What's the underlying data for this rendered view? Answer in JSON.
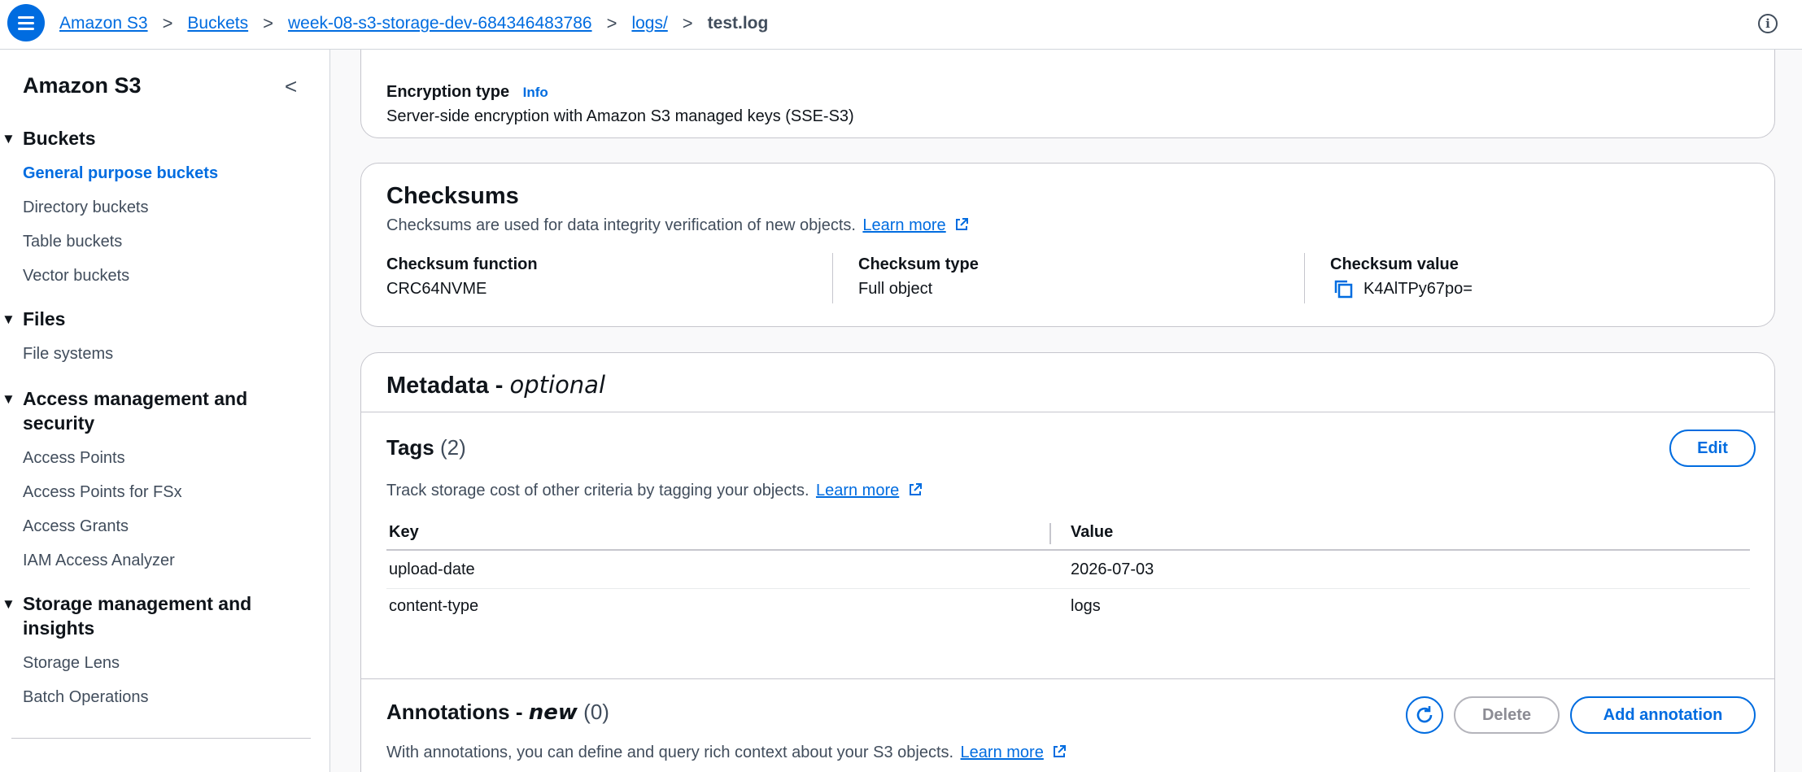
{
  "breadcrumb": {
    "items": [
      "Amazon S3",
      "Buckets",
      "week-08-s3-storage-dev-684346483786",
      "logs/"
    ],
    "current": "test.log",
    "separator": ">"
  },
  "sidebar": {
    "title": "Amazon S3",
    "collapse_glyph": "<",
    "sections": [
      {
        "label": "Buckets",
        "items": [
          "General purpose buckets",
          "Directory buckets",
          "Table buckets",
          "Vector buckets"
        ]
      },
      {
        "label": "Files",
        "items": [
          "File systems"
        ]
      },
      {
        "label": "Access management and security",
        "items": [
          "Access Points",
          "Access Points for FSx",
          "Access Grants",
          "IAM Access Analyzer"
        ]
      },
      {
        "label": "Storage management and insights",
        "items": [
          "Storage Lens",
          "Batch Operations"
        ]
      }
    ],
    "active_item": "General purpose buckets"
  },
  "encryption": {
    "label": "Encryption type",
    "info_link": "Info",
    "value": "Server-side encryption with Amazon S3 managed keys (SSE-S3)"
  },
  "checksums": {
    "title": "Checksums",
    "description": "Checksums are used for data integrity verification of new objects.",
    "learn_more": "Learn more",
    "function_label": "Checksum function",
    "function_value": "CRC64NVME",
    "type_label": "Checksum type",
    "type_value": "Full object",
    "value_label": "Checksum value",
    "value_value": "K4AlTPy67po="
  },
  "metadata": {
    "title": "Metadata - ",
    "title_suffix": "optional",
    "tags": {
      "title": "Tags",
      "count": "(2)",
      "edit_label": "Edit",
      "description": "Track storage cost of other criteria by tagging your objects.",
      "learn_more": "Learn more",
      "columns": [
        "Key",
        "Value"
      ],
      "rows": [
        {
          "key": "upload-date",
          "value": "2026-07-03"
        },
        {
          "key": "content-type",
          "value": "logs"
        }
      ]
    },
    "annotations": {
      "title": "Annotations - ",
      "title_suffix": "new",
      "count": "(0)",
      "delete_label": "Delete",
      "add_label": "Add annotation",
      "description": "With annotations, you can define and query rich context about your S3 objects.",
      "learn_more": "Learn more"
    }
  },
  "colors": {
    "link": "#006ce0",
    "text": "#0f141a",
    "muted": "#414d5c",
    "border": "#c6c6cd"
  }
}
